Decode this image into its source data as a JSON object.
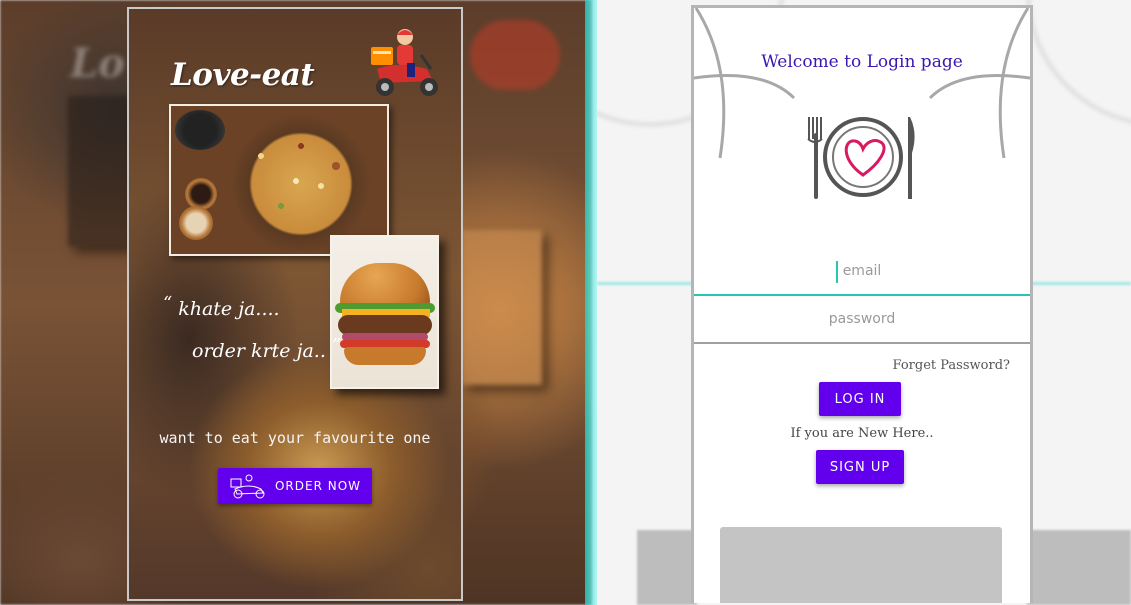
{
  "left_screen": {
    "brand": "Love-eat",
    "quote_line1": "khate ja....",
    "quote_line2": "order krte ja..",
    "quote_open": "“",
    "quote_close": "”",
    "tagline": "want to eat your favourite one",
    "order_button": "ORDER NOW",
    "icons": [
      "delivery-scooter-icon",
      "order-scooter-icon"
    ]
  },
  "right_screen": {
    "title": "Welcome to Login page",
    "email_placeholder": "email",
    "password_placeholder": "password",
    "forget_password": "Forget Password?",
    "login_button": "LOG IN",
    "new_here_text": "If you are New Here..",
    "signup_button": "SIGN UP",
    "icons": [
      "plate-heart-logo-icon"
    ]
  },
  "colors": {
    "accent": "#6200ee",
    "title": "#3a17b0",
    "focus_line": "#2bc3b4"
  }
}
